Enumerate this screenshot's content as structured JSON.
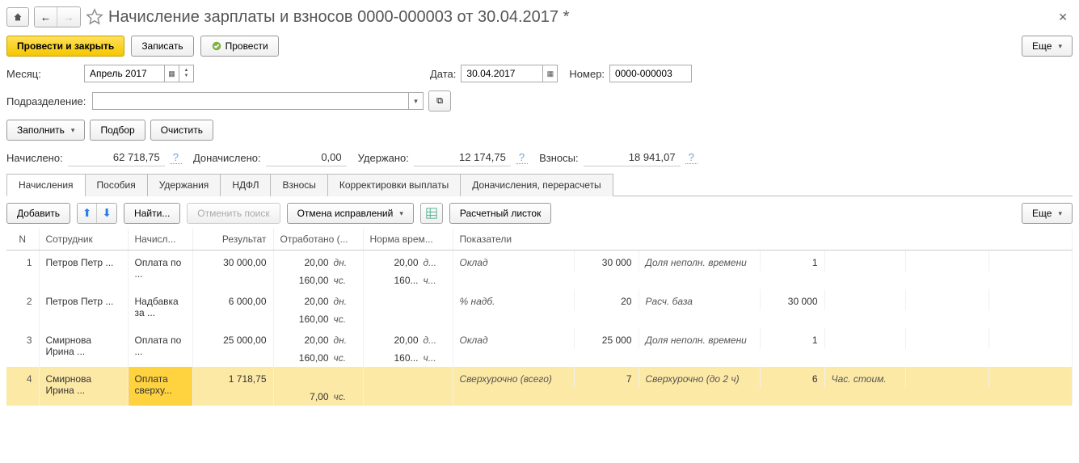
{
  "header": {
    "title": "Начисление зарплаты и взносов 0000-000003 от 30.04.2017 *"
  },
  "actions": {
    "submit_close": "Провести и закрыть",
    "save": "Записать",
    "submit": "Провести",
    "more": "Еще"
  },
  "fields": {
    "month_label": "Месяц:",
    "month_value": "Апрель 2017",
    "date_label": "Дата:",
    "date_value": "30.04.2017",
    "number_label": "Номер:",
    "number_value": "0000-000003",
    "subdivision_label": "Подразделение:",
    "subdivision_value": ""
  },
  "fill_row": {
    "fill": "Заполнить",
    "pick": "Подбор",
    "clear": "Очистить"
  },
  "totals": {
    "accrued_label": "Начислено:",
    "accrued": "62 718,75",
    "extra_label": "Доначислено:",
    "extra": "0,00",
    "withheld_label": "Удержано:",
    "withheld": "12 174,75",
    "contrib_label": "Взносы:",
    "contrib": "18 941,07"
  },
  "tabs": [
    "Начисления",
    "Пособия",
    "Удержания",
    "НДФЛ",
    "Взносы",
    "Корректировки выплаты",
    "Доначисления, перерасчеты"
  ],
  "tab_toolbar": {
    "add": "Добавить",
    "find": "Найти...",
    "cancel_search": "Отменить поиск",
    "cancel_fix": "Отмена исправлений",
    "payslip": "Расчетный листок",
    "more": "Еще"
  },
  "columns": [
    "N",
    "Сотрудник",
    "Начисл...",
    "Результат",
    "Отработано (...",
    "Норма врем...",
    "Показатели"
  ],
  "rows": [
    {
      "n": "1",
      "emp": "Петров Петр ...",
      "acc": "Оплата по ...",
      "res": "30 000,00",
      "work_d": "20,00",
      "work_du": "дн.",
      "work_h": "160,00",
      "work_hu": "чс.",
      "norm_d": "20,00",
      "norm_du": "д...",
      "norm_h": "160...",
      "norm_hu": "ч...",
      "ind1_name": "Оклад",
      "ind1_val": "30 000",
      "ind2_name": "Доля неполн. времени",
      "ind2_val": "1",
      "ind3_name": "",
      "ind3_val": "",
      "ind4_name": ""
    },
    {
      "n": "2",
      "emp": "Петров Петр ...",
      "acc": "Надбавка за ...",
      "res": "6 000,00",
      "work_d": "20,00",
      "work_du": "дн.",
      "work_h": "160,00",
      "work_hu": "чс.",
      "norm_d": "",
      "norm_du": "",
      "norm_h": "",
      "norm_hu": "",
      "ind1_name": "% надб.",
      "ind1_val": "20",
      "ind2_name": "Расч. база",
      "ind2_val": "30 000",
      "ind3_name": "",
      "ind3_val": "",
      "ind4_name": ""
    },
    {
      "n": "3",
      "emp": "Смирнова Ирина ...",
      "acc": "Оплата по ...",
      "res": "25 000,00",
      "work_d": "20,00",
      "work_du": "дн.",
      "work_h": "160,00",
      "work_hu": "чс.",
      "norm_d": "20,00",
      "norm_du": "д...",
      "norm_h": "160...",
      "norm_hu": "ч...",
      "ind1_name": "Оклад",
      "ind1_val": "25 000",
      "ind2_name": "Доля неполн. времени",
      "ind2_val": "1",
      "ind3_name": "",
      "ind3_val": "",
      "ind4_name": ""
    },
    {
      "n": "4",
      "emp": "Смирнова Ирина ...",
      "acc": "Оплата сверху...",
      "res": "1 718,75",
      "work_d": "",
      "work_du": "",
      "work_h": "7,00",
      "work_hu": "чс.",
      "norm_d": "",
      "norm_du": "",
      "norm_h": "",
      "norm_hu": "",
      "ind1_name": "Сверхурочно (всего)",
      "ind1_val": "7",
      "ind2_name": "Сверхурочно (до 2 ч)",
      "ind2_val": "6",
      "ind3_name": "Час. стоим.",
      "ind3_val": "",
      "ind4_name": "",
      "selected": true
    }
  ]
}
